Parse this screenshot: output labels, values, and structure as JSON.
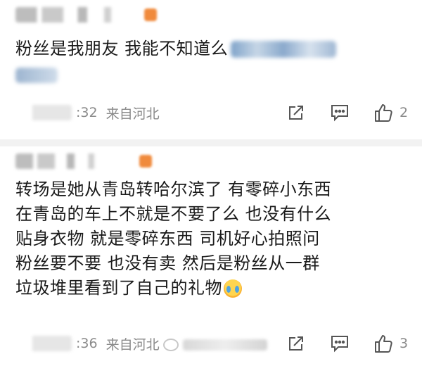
{
  "comments": [
    {
      "text": "粉丝是我朋友 我能不知道么",
      "time": ":32",
      "location": "来自河北",
      "likes": "2"
    },
    {
      "text_lines": [
        "转场是她从青岛转哈尔滨了 有零碎小东西",
        "在青岛的车上不就是不要了么 也没有什么",
        "贴身衣物 就是零碎东西 司机好心拍照问",
        "粉丝要不要 也没有卖 然后是粉丝从一群",
        "垃圾堆里看到了自己的礼物"
      ],
      "emoji": "crying-face",
      "time": ":36",
      "location": "来自河北",
      "likes": "3"
    }
  ],
  "icons": {
    "share": "share-icon",
    "comment": "comment-icon",
    "like": "thumbs-up-icon"
  },
  "colors": {
    "text": "#1a1a1a",
    "meta": "#8a8a8a",
    "divider": "#f2f2f2"
  }
}
